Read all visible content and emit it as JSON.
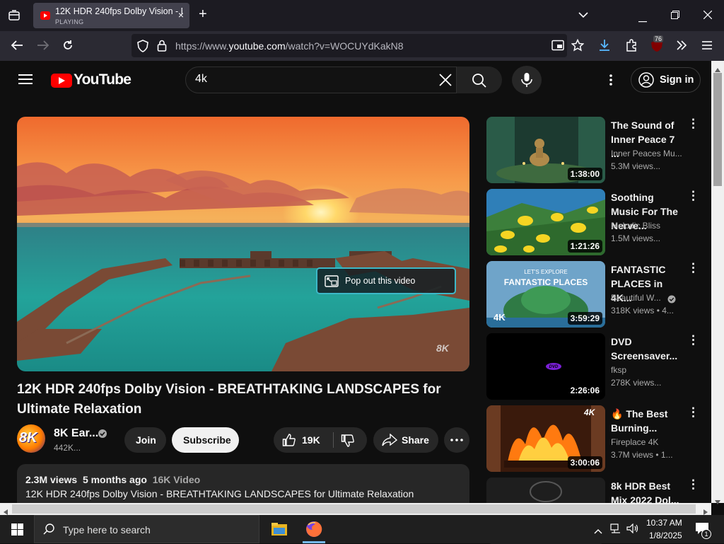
{
  "browser": {
    "tab": {
      "title": "12K HDR 240fps Dolby Vision - B",
      "status": "PLAYING",
      "close": "×"
    },
    "new_tab": "+",
    "url_prefix": "https://www.",
    "url_domain": "youtube.com",
    "url_path": "/watch?v=WOCUYdKakN8",
    "extensions_badge": "76"
  },
  "header": {
    "logo_text": "YouTube",
    "search_value": "4k",
    "sign_in_label": "Sign in"
  },
  "video": {
    "title": "12K HDR 240fps Dolby Vision - BREATHTAKING LANDSCAPES for Ultimate Relaxation",
    "popout_label": "Pop out this video",
    "watermark": "8K"
  },
  "channel": {
    "avatar_text": "8K",
    "name": "8K Ear...",
    "subscribers": "442K...",
    "join_label": "Join",
    "subscribe_label": "Subscribe"
  },
  "actions": {
    "likes": "19K",
    "share_label": "Share"
  },
  "description": {
    "views": "2.3M views",
    "age": "5 months ago",
    "tag": "16K Video",
    "text": "12K HDR 240fps Dolby Vision - BREATHTAKING LANDSCAPES for Ultimate Relaxation"
  },
  "recommendations": [
    {
      "title": "The Sound of Inner Peace 7 ...",
      "channel": "Inner Peaces Mu...",
      "views": "5.3M views...",
      "duration": "1:38:00"
    },
    {
      "title": "Soothing Music For The Nerve...",
      "channel": "Melodic Bliss",
      "views": "1.5M views...",
      "duration": "1:21:26"
    },
    {
      "title": "FANTASTIC PLACES in 4K...",
      "channel": "Beautiful W...",
      "views": "318K views • 4...",
      "duration": "3:59:29",
      "thumb_line1": "LET'S EXPLORE",
      "thumb_line2": "FANTASTIC PLACES",
      "thumb_badge": "4K"
    },
    {
      "title": "DVD Screensaver...",
      "channel": "fksp",
      "views": "278K views...",
      "duration": "2:26:06",
      "thumb_text": "DVD"
    },
    {
      "title": "🔥 The Best Burning...",
      "channel": "Fireplace 4K",
      "views": "3.7M views • 1...",
      "duration": "3:00:06",
      "thumb_badge": "4K"
    },
    {
      "title": "8k HDR Best Mix 2022 Dol...",
      "channel": "",
      "views": "",
      "duration": ""
    }
  ],
  "taskbar": {
    "search_placeholder": "Type here to search",
    "time": "10:37 AM",
    "date": "1/8/2025",
    "notification_count": "1"
  },
  "colors": {
    "youtube_red": "#ff0000",
    "background": "#0f0f0f",
    "chip": "#272727",
    "popout_border": "#3cb8c8"
  }
}
